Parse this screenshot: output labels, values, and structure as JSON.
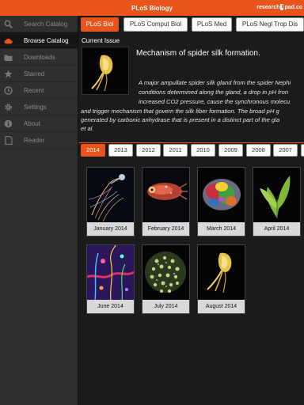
{
  "app": {
    "title": "PLoS Biology",
    "brand_left": "research",
    "brand_mid": "i",
    "brand_right": "pad.co",
    "accent": "#e8541b"
  },
  "sidebar": {
    "items": [
      {
        "label": "Search Catalog",
        "icon": "search-icon",
        "active": false
      },
      {
        "label": "Browse Catalog",
        "icon": "cloud-icon",
        "active": true
      },
      {
        "label": "Downloads",
        "icon": "folder-icon",
        "active": false
      },
      {
        "label": "Starred",
        "icon": "star-icon",
        "active": false
      },
      {
        "label": "Recent",
        "icon": "clock-icon",
        "active": false
      },
      {
        "label": "Settings",
        "icon": "gear-icon",
        "active": false
      },
      {
        "label": "About",
        "icon": "info-icon",
        "active": false
      },
      {
        "label": "Reader",
        "icon": "document-icon",
        "active": false
      }
    ]
  },
  "journals": [
    {
      "label": "PLoS Biol",
      "active": true
    },
    {
      "label": "PLoS Comput Biol",
      "active": false
    },
    {
      "label": "PLoS Med",
      "active": false
    },
    {
      "label": "PLoS Negl Trop Dis",
      "active": false
    }
  ],
  "current_issue": {
    "label": "Current Issue",
    "article_title": "Mechanism of spider silk formation.",
    "abstract_lines": [
      "A major ampullate spider silk gland from the spider Nephi",
      "conditions determined along the gland, a drop in pH fron",
      "increased CO2 pressure, cause the synchronous molecu",
      "and trigger mechanism that govern the silk fiber formation. The broad pH g",
      "generated by carbonic anhydrase that is present in a distinct part of the gla",
      "et al."
    ]
  },
  "years": [
    {
      "label": "2014",
      "active": true
    },
    {
      "label": "2013",
      "active": false
    },
    {
      "label": "2012",
      "active": false
    },
    {
      "label": "2011",
      "active": false
    },
    {
      "label": "2010",
      "active": false
    },
    {
      "label": "2009",
      "active": false
    },
    {
      "label": "2008",
      "active": false
    },
    {
      "label": "2007",
      "active": false
    }
  ],
  "issues": [
    {
      "label": "January 2014"
    },
    {
      "label": "February 2014"
    },
    {
      "label": "March 2014"
    },
    {
      "label": "April 2014"
    },
    {
      "label": "June 2014"
    },
    {
      "label": "July 2014"
    },
    {
      "label": "August 2014"
    }
  ]
}
